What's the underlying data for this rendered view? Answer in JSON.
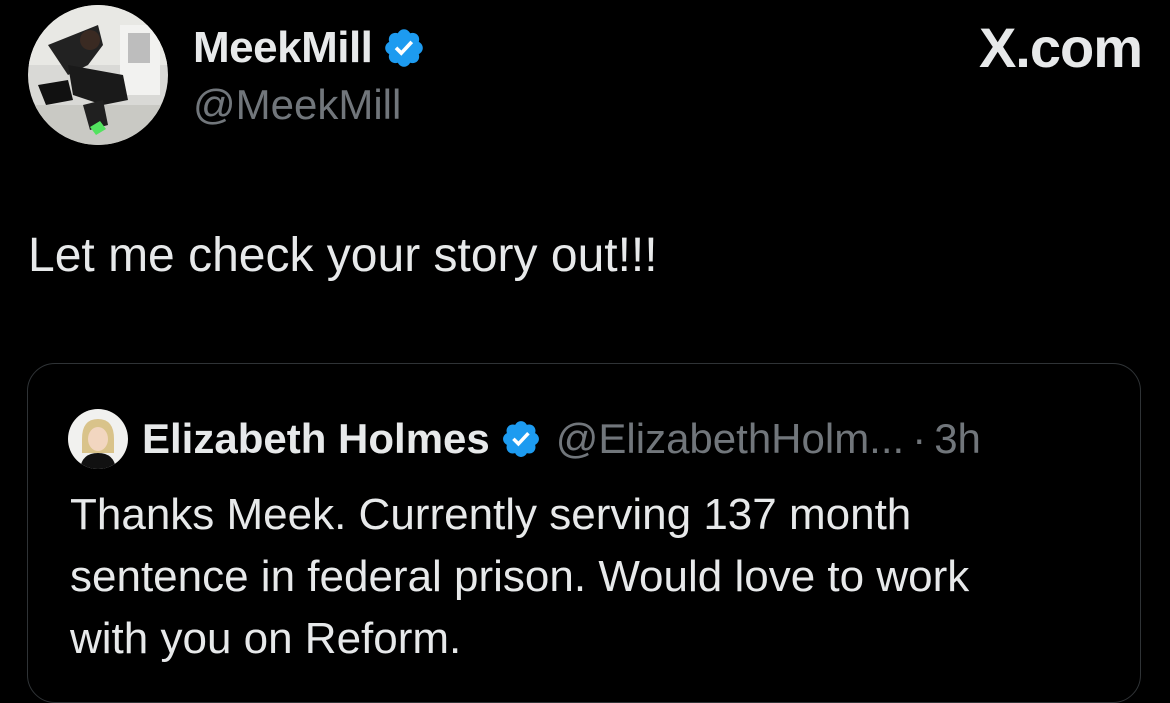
{
  "author": {
    "display_name": "MeekMill",
    "handle": "@MeekMill",
    "verified_icon": "verified-badge-icon",
    "avatar_icon": "avatar"
  },
  "site_label": "X.com",
  "tweet": {
    "text": "Let me check your story out!!!"
  },
  "quoted_tweet": {
    "display_name": "Elizabeth Holmes",
    "handle": "@ElizabethHolm...",
    "separator": "·",
    "time": "3h",
    "text_lines": [
      "Thanks Meek. Currently serving 137 month",
      "sentence in federal prison. Would love to work",
      "with you on Reform."
    ]
  },
  "colors": {
    "background": "#000000",
    "primary_text": "#e7e9ea",
    "secondary_text": "#71767b",
    "verified_blue": "#1d9bf0",
    "border": "#2f3336"
  }
}
